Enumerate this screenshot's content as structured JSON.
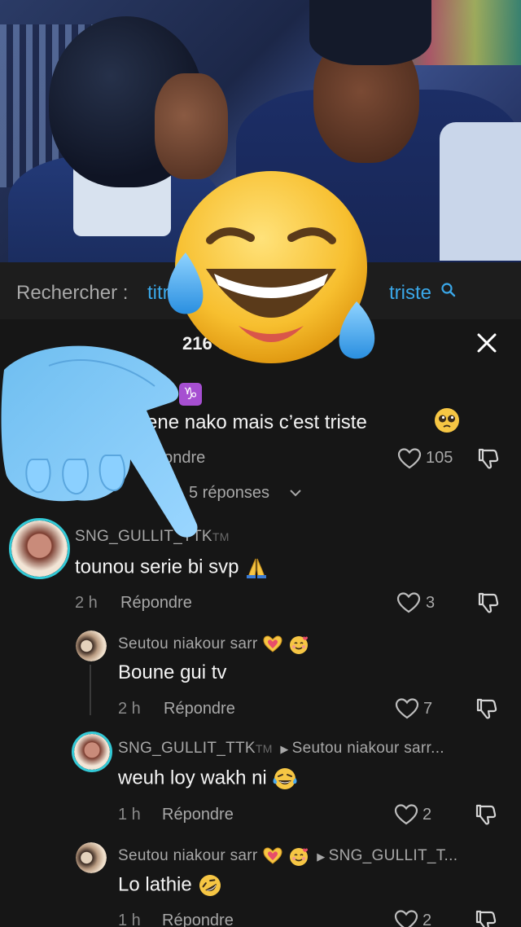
{
  "search": {
    "label": "Rechercher :",
    "prefix": "titre",
    "suffix": "triste"
  },
  "comments_header": {
    "count": "216 c"
  },
  "comments": [
    {
      "user": "",
      "badge": "♑",
      "text": "sétene nako mais c’est triste",
      "reply_label": "pondre",
      "likes": "105",
      "view_replies": "5 réponses"
    },
    {
      "user": "SNG_GULLIT_TTK",
      "badge": "TM",
      "text": "tounou serie bi svp",
      "time": "2 h",
      "reply_label": "Répondre",
      "likes": "3"
    }
  ],
  "replies": [
    {
      "user": "Seutou niakour sarr",
      "text": "Boune gui tv",
      "time": "2 h",
      "reply_label": "Répondre",
      "likes": "7"
    },
    {
      "user": "SNG_GULLIT_TTK",
      "badge": "TM",
      "reply_to": "Seutou niakour sarr...",
      "text": "weuh loy wakh ni",
      "time": "1 h",
      "reply_label": "Répondre",
      "likes": "2"
    },
    {
      "user": "Seutou niakour sarr",
      "reply_to": "SNG_GULLIT_T...",
      "text": "Lo lathie",
      "time": "1 h",
      "reply_label": "Répondre",
      "likes": "2"
    }
  ],
  "colors": {
    "accent": "#3aa7e8",
    "avatar_ring": "#33c9d6",
    "background": "#161616"
  },
  "icons": [
    "search-icon",
    "close-icon",
    "heart-icon",
    "dislike-icon",
    "chevron-down-icon",
    "laughing-tears-emoji",
    "pointing-hand-emoji"
  ]
}
